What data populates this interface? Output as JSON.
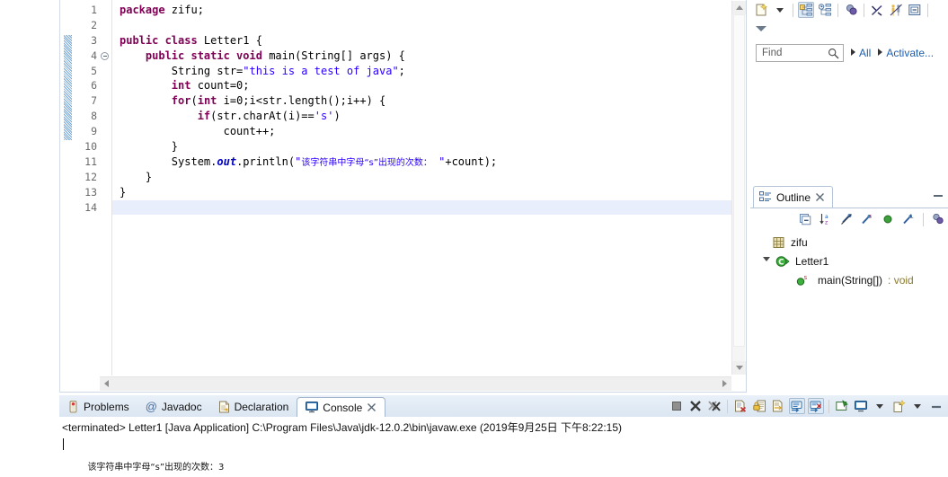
{
  "editor": {
    "name": "java-source-editor",
    "current_line": 14,
    "change_marker_lines": "4-12",
    "line_numbers": [
      1,
      2,
      3,
      4,
      5,
      6,
      7,
      8,
      9,
      10,
      11,
      12,
      13,
      14
    ],
    "fold_marker_line": 4,
    "lines": [
      {
        "n": 1,
        "tokens": [
          {
            "t": "package ",
            "c": "kw"
          },
          {
            "t": "zifu;",
            "c": "plain"
          }
        ]
      },
      {
        "n": 2,
        "tokens": []
      },
      {
        "n": 3,
        "tokens": [
          {
            "t": "public class ",
            "c": "kw"
          },
          {
            "t": "Letter1 {",
            "c": "plain"
          }
        ]
      },
      {
        "n": 4,
        "tokens": [
          {
            "t": "    ",
            "c": "plain"
          },
          {
            "t": "public static void ",
            "c": "kw"
          },
          {
            "t": "main(String[] args) {",
            "c": "plain"
          }
        ]
      },
      {
        "n": 5,
        "tokens": [
          {
            "t": "        String str=",
            "c": "plain"
          },
          {
            "t": "\"this is a test of java\"",
            "c": "str"
          },
          {
            "t": ";",
            "c": "plain"
          }
        ]
      },
      {
        "n": 6,
        "tokens": [
          {
            "t": "        ",
            "c": "plain"
          },
          {
            "t": "int ",
            "c": "kw"
          },
          {
            "t": "count=0;",
            "c": "plain"
          }
        ]
      },
      {
        "n": 7,
        "tokens": [
          {
            "t": "        ",
            "c": "plain"
          },
          {
            "t": "for",
            "c": "kw"
          },
          {
            "t": "(",
            "c": "plain"
          },
          {
            "t": "int ",
            "c": "kw"
          },
          {
            "t": "i=0;i<str.length();i++) {",
            "c": "plain"
          }
        ]
      },
      {
        "n": 8,
        "tokens": [
          {
            "t": "            ",
            "c": "plain"
          },
          {
            "t": "if",
            "c": "kw"
          },
          {
            "t": "(str.charAt(i)==",
            "c": "plain"
          },
          {
            "t": "'s'",
            "c": "str"
          },
          {
            "t": ")",
            "c": "plain"
          }
        ]
      },
      {
        "n": 9,
        "tokens": [
          {
            "t": "                count++;",
            "c": "plain"
          }
        ]
      },
      {
        "n": 10,
        "tokens": [
          {
            "t": "        }",
            "c": "plain"
          }
        ]
      },
      {
        "n": 11,
        "tokens": [
          {
            "t": "        System.",
            "c": "plain"
          },
          {
            "t": "out",
            "c": "fld"
          },
          {
            "t": ".println(",
            "c": "plain"
          },
          {
            "t": "\"",
            "c": "str"
          },
          {
            "t": "该字符串中字母“s”出现的次数：",
            "c": "cjk"
          },
          {
            "t": " \"",
            "c": "str"
          },
          {
            "t": "+count);",
            "c": "plain"
          }
        ]
      },
      {
        "n": 12,
        "tokens": [
          {
            "t": "    }",
            "c": "plain"
          }
        ]
      },
      {
        "n": 13,
        "tokens": [
          {
            "t": "}",
            "c": "plain"
          }
        ]
      },
      {
        "n": 14,
        "tokens": []
      }
    ]
  },
  "right_panel": {
    "toolbar": [
      {
        "name": "new-java-file-icon",
        "label": "New"
      },
      {
        "name": "dropdown-arrow-icon",
        "label": ""
      },
      {
        "name": "show-hierarchy-icon",
        "label": "Hierarchy",
        "pressed": true
      },
      {
        "name": "show-history-icon",
        "label": "History",
        "pressed": false
      },
      {
        "name": "debug-icon",
        "label": "Debug"
      },
      {
        "name": "break-link-icon",
        "label": "Unlink"
      },
      {
        "name": "compare-icon",
        "label": "Compare"
      },
      {
        "name": "collapse-all-icon",
        "label": "Collapse All"
      }
    ],
    "expand_caret": "expand-caret-icon",
    "find": {
      "placeholder": "Find",
      "value": "",
      "search_icon": "search-icon"
    },
    "links": [
      {
        "label": "All",
        "name": "all-link"
      },
      {
        "label": "Activate...",
        "name": "activate-link"
      }
    ]
  },
  "outline": {
    "tab_label": "Outline",
    "tab_icon": "outline-icon",
    "close_icon": "close-icon",
    "minimize_icon": "minimize-icon",
    "toolbar": [
      {
        "name": "collapse-all-icon"
      },
      {
        "name": "sort-alphabetically-icon"
      },
      {
        "name": "hide-non-public-icon"
      },
      {
        "name": "hide-static-icon"
      },
      {
        "name": "hide-fields-icon"
      },
      {
        "name": "hide-local-types-icon"
      },
      {
        "name": "view-menu-icon"
      }
    ],
    "tree": [
      {
        "label": "zifu",
        "icon": "package-icon",
        "indent": 0,
        "arrow": "none",
        "type": ""
      },
      {
        "label": "Letter1",
        "icon": "class-icon",
        "indent": 0,
        "arrow": "open",
        "type": ""
      },
      {
        "label": "main(String[])",
        "icon": "method-public-static-icon",
        "indent": 1,
        "arrow": "none",
        "type": " : void"
      }
    ]
  },
  "console": {
    "tabs": [
      {
        "label": "Problems",
        "icon": "problems-icon",
        "active": false
      },
      {
        "label": "Javadoc",
        "icon": "javadoc-icon",
        "active": false
      },
      {
        "label": "Declaration",
        "icon": "declaration-icon",
        "active": false
      },
      {
        "label": "Console",
        "icon": "console-icon",
        "active": true,
        "close_icon": "close-icon"
      }
    ],
    "toolbar": [
      {
        "name": "terminate-icon"
      },
      {
        "name": "remove-launch-icon"
      },
      {
        "name": "remove-all-terminated-icon"
      },
      {
        "name": "clear-console-icon"
      },
      {
        "name": "scroll-lock-icon"
      },
      {
        "name": "word-wrap-icon"
      },
      {
        "name": "show-console-on-output-icon",
        "pressed": true
      },
      {
        "name": "show-console-on-error-icon",
        "pressed": true
      },
      {
        "name": "pin-console-icon"
      },
      {
        "name": "display-selected-console-icon"
      },
      {
        "name": "dropdown-arrow-icon"
      },
      {
        "name": "open-console-icon"
      },
      {
        "name": "dropdown-arrow-icon-2"
      },
      {
        "name": "minimize-icon"
      }
    ],
    "terminated_line": "<terminated> Letter1 [Java Application] C:\\Program Files\\Java\\jdk-12.0.2\\bin\\javaw.exe (2019年9月25日 下午8:22:15)",
    "output": "该字符串中字母“s”出现的次数：3"
  },
  "colors": {
    "keyword": "#7f0055",
    "string": "#2a00ff",
    "field": "#0000c0",
    "current_line_bg": "#e8eefb",
    "tab_strip": "#dbe6f2",
    "link": "#1a5fb4",
    "return_type": "#8a7a30"
  }
}
